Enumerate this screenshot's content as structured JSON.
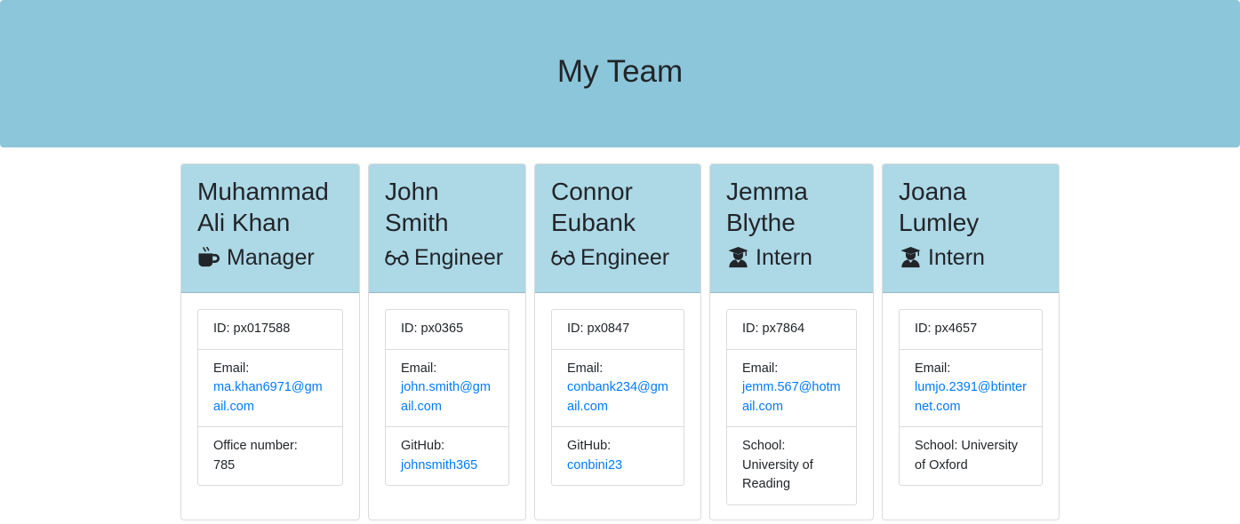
{
  "header": {
    "title": "My Team"
  },
  "colors": {
    "jumbotron": "#8cc6da",
    "card_header": "#add8e6",
    "link": "#007bff"
  },
  "employees": [
    {
      "name_line1": "Muhammad",
      "name_line2": "Ali Khan",
      "role": "Manager",
      "role_icon": "mug-hot-icon",
      "id": "ID: px017588",
      "email_label": "Email:",
      "email": "ma.khan6971@gmail.com",
      "extra_label": "Office number:",
      "extra_value": "785"
    },
    {
      "name_line1": "John",
      "name_line2": "Smith",
      "role": "Engineer",
      "role_icon": "glasses-icon",
      "id": "ID: px0365",
      "email_label": "Email:",
      "email": "john.smith@gmail.com",
      "extra_label": "GitHub:",
      "extra_value": "johnsmith365"
    },
    {
      "name_line1": "Connor",
      "name_line2": "Eubank",
      "role": "Engineer",
      "role_icon": "glasses-icon",
      "id": "ID: px0847",
      "email_label": "Email:",
      "email": "conbank234@gmail.com",
      "extra_label": "GitHub:",
      "extra_value": "conbini23"
    },
    {
      "name_line1": "Jemma",
      "name_line2": "Blythe",
      "role": "Intern",
      "role_icon": "user-graduate-icon",
      "id": "ID: px7864",
      "email_label": "Email:",
      "email": "jemm.567@hotmail.com",
      "extra_label": "School:",
      "extra_value": "University of Reading"
    },
    {
      "name_line1": "Joana",
      "name_line2": "Lumley",
      "role": "Intern",
      "role_icon": "user-graduate-icon",
      "id": "ID: px4657",
      "email_label": "Email:",
      "email": "lumjo.2391@btinternet.com",
      "extra_label": "School:",
      "extra_value": "University of Oxford"
    }
  ]
}
